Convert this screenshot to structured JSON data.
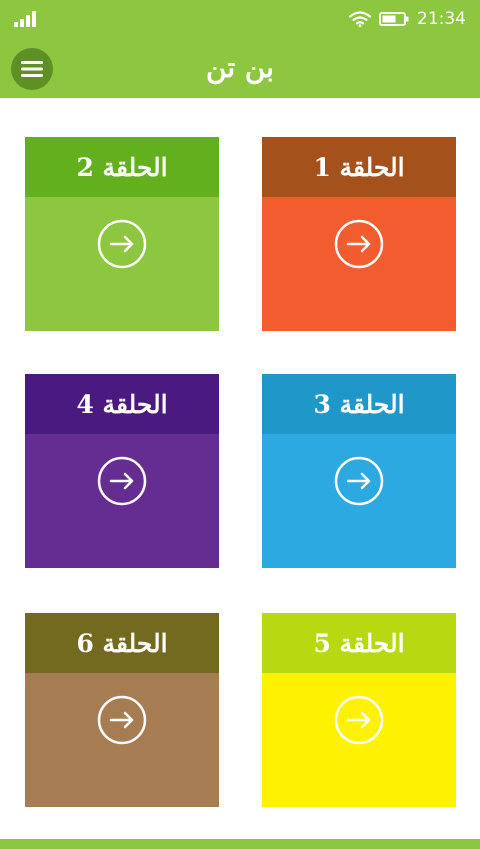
{
  "status_bar": {
    "time": "21:34",
    "icons": [
      "signal-icon",
      "wifi-icon",
      "battery-icon"
    ]
  },
  "app_bar": {
    "title": "بن تن",
    "menu_icon": "hamburger-menu-icon"
  },
  "tiles": [
    {
      "label": "الحلقة 1",
      "header_color": "#a4511b",
      "body_color": "#f25c2f"
    },
    {
      "label": "الحلقة 2",
      "header_color": "#62b01e",
      "body_color": "#8dc63f"
    },
    {
      "label": "الحلقة 3",
      "header_color": "#1f97c9",
      "body_color": "#2ca9e1"
    },
    {
      "label": "الحلقة 4",
      "header_color": "#4b1a80",
      "body_color": "#652d91"
    },
    {
      "label": "الحلقة 5",
      "header_color": "#b8d812",
      "body_color": "#fff200"
    },
    {
      "label": "الحلقة 6",
      "header_color": "#736a1f",
      "body_color": "#a67c52"
    }
  ],
  "tile_action_icon": "arrow-right-circle-icon",
  "colors": {
    "bar": "#8dc63f",
    "menu_button": "#5f8f27"
  }
}
